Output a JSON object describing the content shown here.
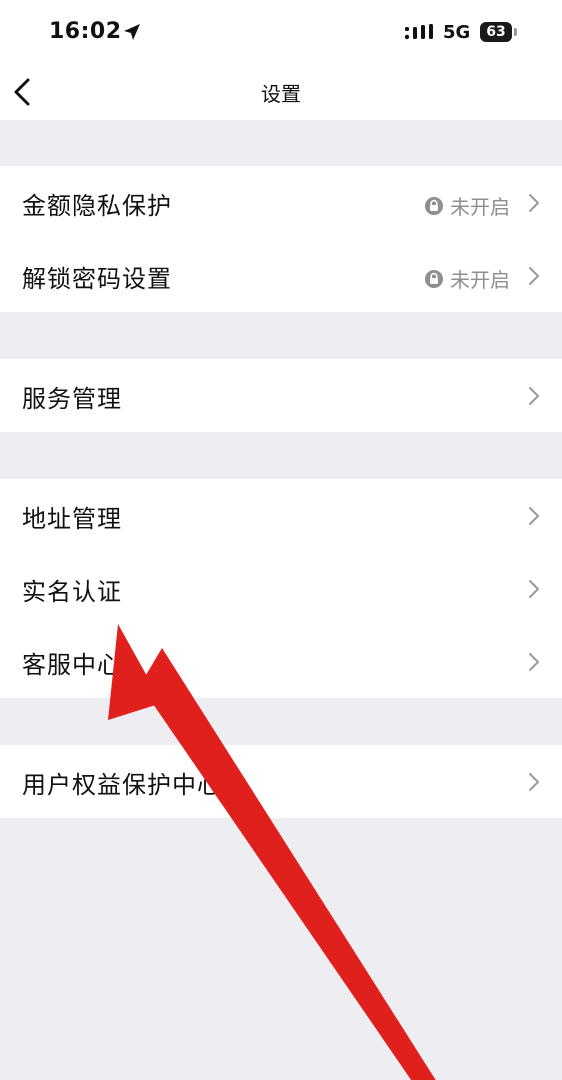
{
  "status_bar": {
    "time": "16:02",
    "network": "5G",
    "battery": "63"
  },
  "nav": {
    "title": "设置"
  },
  "groups": [
    {
      "items": [
        {
          "label": "金额隐私保护",
          "status": "未开启"
        },
        {
          "label": "解锁密码设置",
          "status": "未开启"
        }
      ]
    },
    {
      "items": [
        {
          "label": "服务管理"
        }
      ]
    },
    {
      "items": [
        {
          "label": "地址管理"
        },
        {
          "label": "实名认证"
        },
        {
          "label": "客服中心"
        }
      ]
    },
    {
      "items": [
        {
          "label": "用户权益保护中心"
        }
      ]
    }
  ],
  "colors": {
    "background": "#eeedf2",
    "row_background": "#ffffff",
    "secondary_text": "#8e8e93",
    "annotation_arrow": "#e0201c"
  },
  "icons": {
    "back": "chevron-left-icon",
    "row_arrow": "chevron-right-icon",
    "status": "lock-icon",
    "location": "location-arrow-icon",
    "signal": "signal-icon"
  }
}
